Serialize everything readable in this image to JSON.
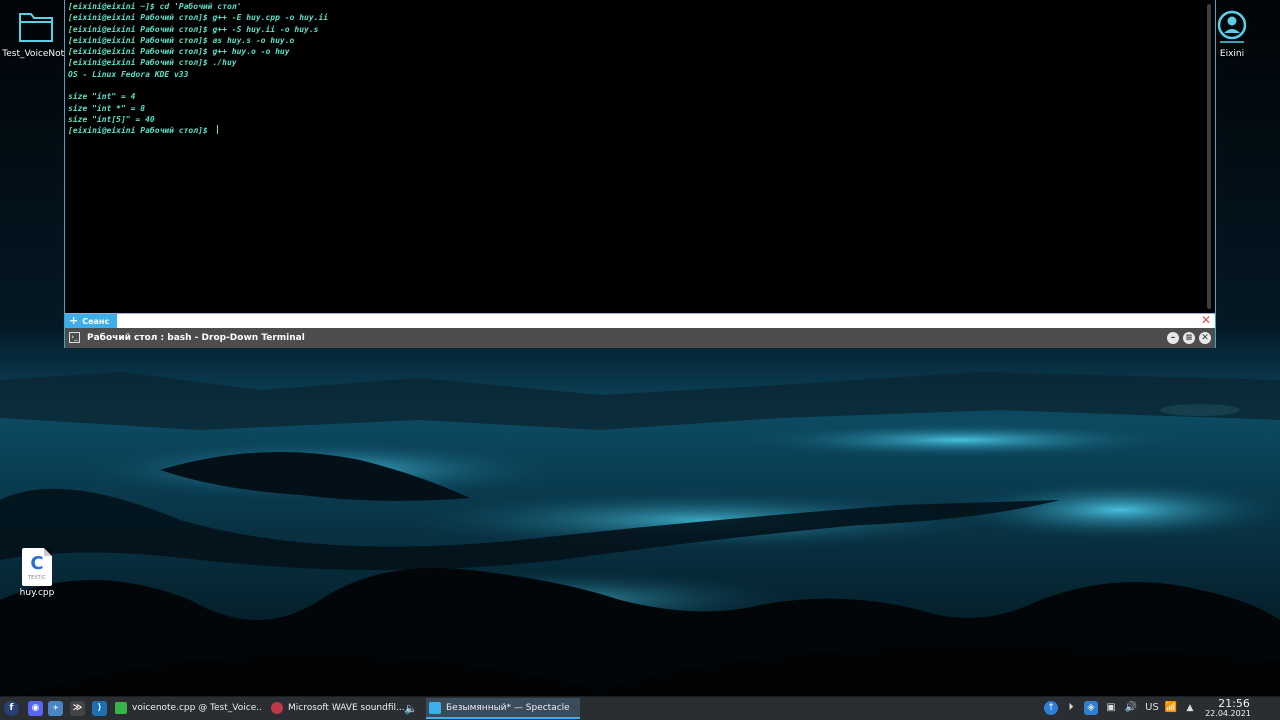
{
  "desktop": {
    "icons": [
      {
        "label": "Test_VoiceNote"
      },
      {
        "label": "Eixini"
      },
      {
        "label": "huy.cpp",
        "badge": "C",
        "sub": "TEXT/C"
      }
    ]
  },
  "terminal": {
    "lines": [
      "[eixini@eixini ~]$ cd 'Рабочий стол'",
      "[eixini@eixini Рабочий стол]$ g++ -E huy.cpp -o huy.ii",
      "[eixini@eixini Рабочий стол]$ g++ -S huy.ii -o huy.s",
      "[eixini@eixini Рабочий стол]$ as huy.s -o huy.o",
      "[eixini@eixini Рабочий стол]$ g++ huy.o -o huy",
      "[eixini@eixini Рабочий стол]$ ./huy",
      "OS - Linux Fedora KDE v33",
      "",
      "size \"int\" = 4",
      "size \"int *\" = 8",
      "size \"int[5]\" = 40",
      "[eixini@eixini Рабочий стол]$ "
    ],
    "tab_label": "Сеанс",
    "window_title": "Рабочий стол : bash - Drop-Down Terminal"
  },
  "taskbar": {
    "tasks": [
      {
        "label": "voicenote.cpp @ Test_Voice...",
        "color": "#38b549"
      },
      {
        "label": "Microsoft WAVE soundfil...",
        "color": "#c0394b"
      },
      {
        "label": "Безымянный* — Spectacle",
        "color": "#3daee9"
      }
    ],
    "keyboard_layout": "US",
    "clock_time": "21:56",
    "clock_date": "22.04.2021"
  },
  "colors": {
    "accent": "#3daee9",
    "terminal_text": "#5be0c8",
    "panel": "#2a2e32"
  }
}
